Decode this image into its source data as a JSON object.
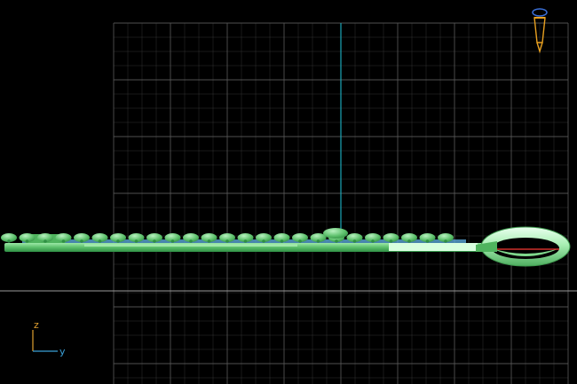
{
  "viewport": {
    "background_color": "#000000",
    "grid_color": "#5a5a5a",
    "ground_line_color": "#9a9a9a",
    "center_axis_color": "#1aa6b7",
    "model_colors": {
      "body": "#5bbf6a",
      "body_light": "#8fe39a",
      "body_dark": "#2f8f44",
      "highlight": "#cfffd6",
      "accent_blue": "#5aa7d8",
      "tip_red": "#d0302a"
    }
  },
  "axis_gizmo": {
    "z_label": "z",
    "y_label": "y",
    "z_color": "#e0a030",
    "y_color": "#3aa0d8"
  },
  "camera_icon": {
    "icon": "camera-frustum-icon",
    "frame_color": "#e8a020",
    "lens_color": "#3a6fd8"
  }
}
